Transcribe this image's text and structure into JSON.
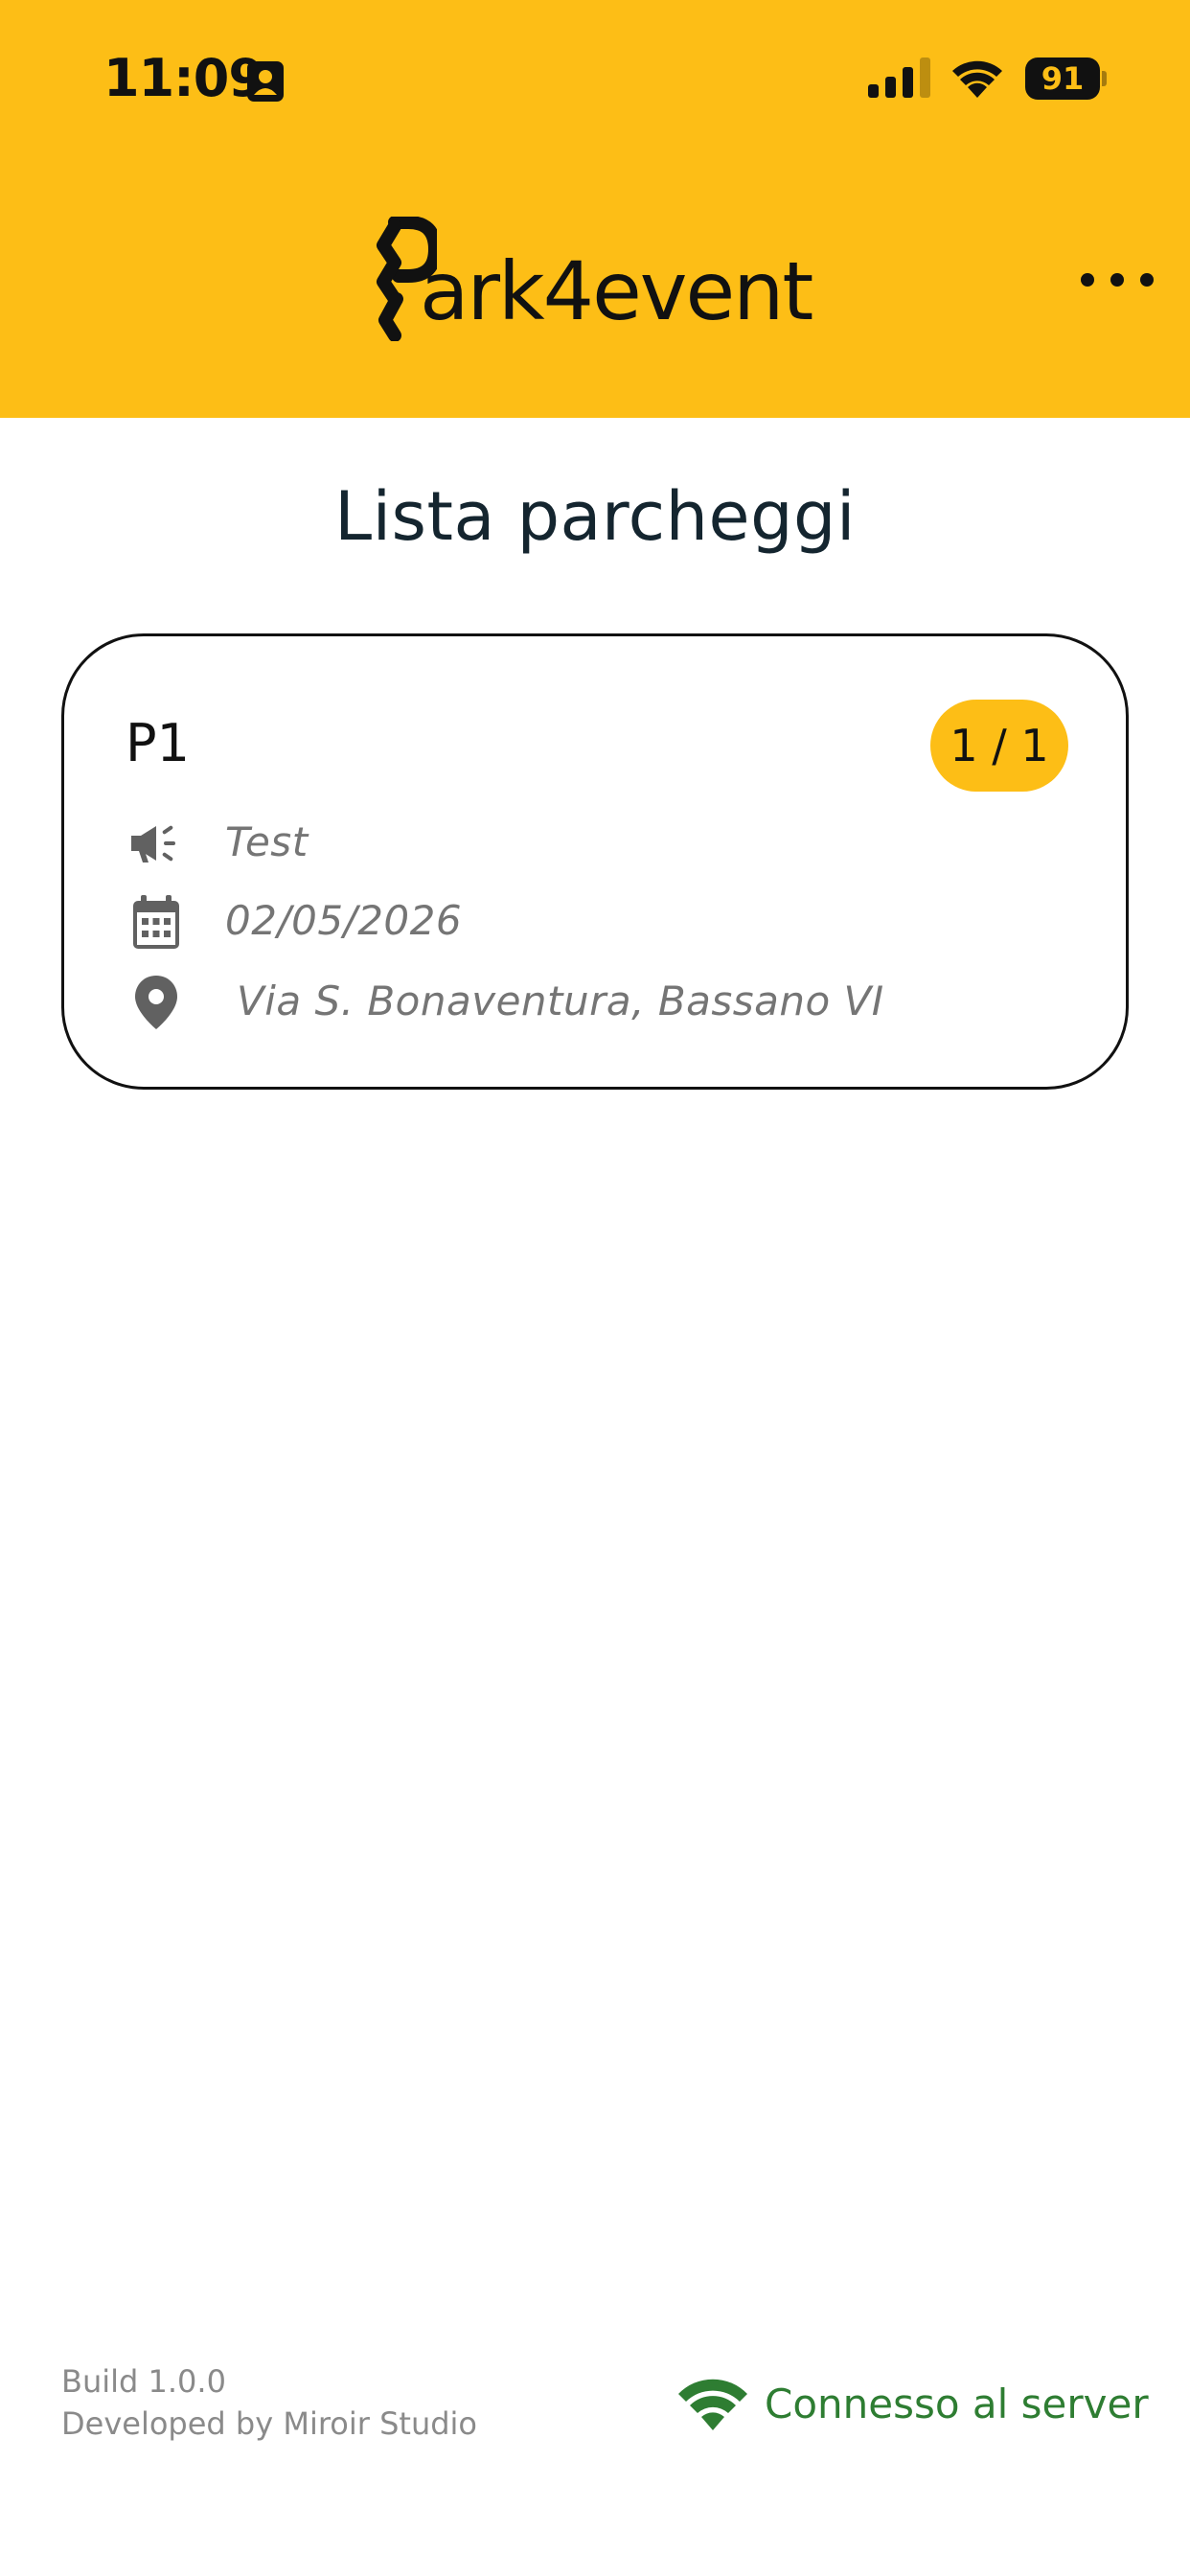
{
  "status_bar": {
    "time": "11:09",
    "battery": "91"
  },
  "header": {
    "logo_text": "ark4event",
    "menu_icon": "more-horizontal-icon"
  },
  "main": {
    "page_title": "Lista parcheggi",
    "parkings": [
      {
        "name": "P1",
        "badge": "1 / 1",
        "event": "Test",
        "event_icon": "megaphone-icon",
        "date": "02/05/2026",
        "date_icon": "calendar-icon",
        "address": "Via S. Bonaventura, Bassano VI",
        "address_icon": "location-pin-icon"
      }
    ]
  },
  "footer": {
    "build": "Build 1.0.0",
    "developer": "Developed by Miroir Studio",
    "server_status": "Connesso al server",
    "server_status_color": "#2E7D32"
  },
  "colors": {
    "accent": "#FDBE16",
    "text_dark": "#14252f",
    "text_muted": "#757575"
  }
}
